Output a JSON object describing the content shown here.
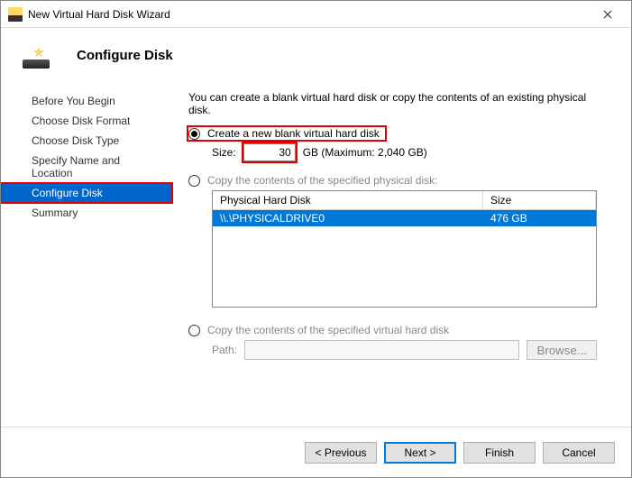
{
  "title": "New Virtual Hard Disk Wizard",
  "page_heading": "Configure Disk",
  "steps": [
    {
      "label": "Before You Begin",
      "active": false,
      "highlighted": false
    },
    {
      "label": "Choose Disk Format",
      "active": false,
      "highlighted": false
    },
    {
      "label": "Choose Disk Type",
      "active": false,
      "highlighted": false
    },
    {
      "label": "Specify Name and Location",
      "active": false,
      "highlighted": false
    },
    {
      "label": "Configure Disk",
      "active": true,
      "highlighted": true
    },
    {
      "label": "Summary",
      "active": false,
      "highlighted": false
    }
  ],
  "intro": "You can create a blank virtual hard disk or copy the contents of an existing physical disk.",
  "option_create_blank": {
    "label": "Create a new blank virtual hard disk",
    "checked": true,
    "size_label": "Size:",
    "size_value": "30",
    "size_suffix": "GB (Maximum: 2,040 GB)"
  },
  "option_copy_physical": {
    "label": "Copy the contents of the specified physical disk:",
    "checked": false,
    "columns": {
      "disk": "Physical Hard Disk",
      "size": "Size"
    },
    "rows": [
      {
        "disk": "\\\\.\\PHYSICALDRIVE0",
        "size": "476 GB",
        "selected": true
      }
    ]
  },
  "option_copy_virtual": {
    "label": "Copy the contents of the specified virtual hard disk",
    "checked": false,
    "path_label": "Path:",
    "path_value": "",
    "browse_label": "Browse..."
  },
  "buttons": {
    "previous": "< Previous",
    "next": "Next >",
    "finish": "Finish",
    "cancel": "Cancel"
  }
}
